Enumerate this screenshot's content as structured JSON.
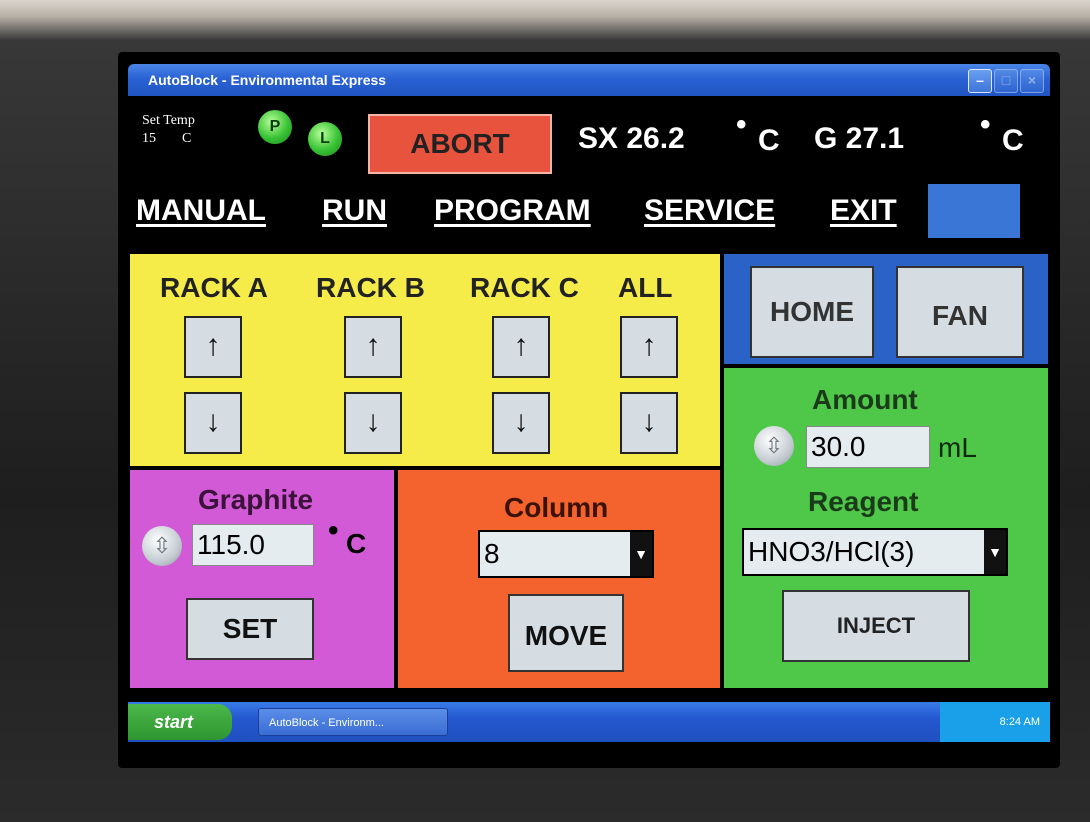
{
  "window": {
    "title": "AutoBlock - Environmental Express"
  },
  "header": {
    "set_temp_label": "Set Temp",
    "set_temp_value": "15",
    "set_temp_unit": "C",
    "led_p": "P",
    "led_l": "L",
    "abort_label": "ABORT",
    "sx_reading": "SX 26.2",
    "g_reading": "G 27.1",
    "degree_unit": "C"
  },
  "menu": [
    "MANUAL",
    "RUN",
    "PROGRAM",
    "SERVICE",
    "EXIT"
  ],
  "racks": {
    "labels": [
      "RACK A",
      "RACK B",
      "RACK C",
      "ALL"
    ],
    "up_glyph": "↑",
    "down_glyph": "↓"
  },
  "controls": {
    "home_label": "HOME",
    "fan_label": "FAN",
    "amount_label": "Amount",
    "amount_value": "30.0",
    "amount_unit": "mL",
    "reagent_label": "Reagent",
    "reagent_value": "HNO3/HCl(3)",
    "inject_label": "INJECT"
  },
  "graphite": {
    "label": "Graphite",
    "value": "115.0",
    "unit": "C",
    "set_label": "SET"
  },
  "column": {
    "label": "Column",
    "value": "8",
    "move_label": "MOVE"
  },
  "taskbar": {
    "start_label": "start",
    "task_label": "AutoBlock - Environm...",
    "clock": "8:24 AM"
  }
}
